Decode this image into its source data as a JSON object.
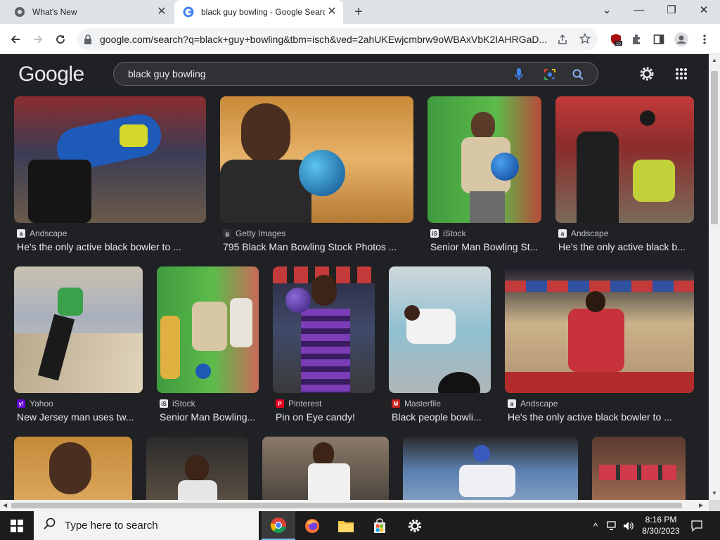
{
  "browser": {
    "tabs": [
      {
        "title": "What's New",
        "active": false
      },
      {
        "title": "black guy bowling - Google Search",
        "active": true
      }
    ],
    "url": "google.com/search?q=black+guy+bowling&tbm=isch&ved=2ahUKEwjcmbrw9oWBAxVbK2IAHRGaD...",
    "extension_badge": "10"
  },
  "google": {
    "logo": "Google",
    "query": "black guy bowling"
  },
  "results": [
    {
      "source": "Andscape",
      "title": "He's the only active black bowler to ...",
      "fav_color": "#e8eaed"
    },
    {
      "source": "Getty Images",
      "title": "795 Black Man Bowling Stock Photos ...",
      "fav_color": "#e8eaed"
    },
    {
      "source": "iStock",
      "title": "Senior Man Bowling St...",
      "fav_color": "#e8eaed"
    },
    {
      "source": "Andscape",
      "title": "He's the only active black b...",
      "fav_color": "#e8eaed"
    },
    {
      "source": "Yahoo",
      "title": "New Jersey man uses tw...",
      "fav_color": "#6001d2"
    },
    {
      "source": "iStock",
      "title": "Senior Man Bowling...",
      "fav_color": "#e8eaed"
    },
    {
      "source": "Pinterest",
      "title": "Pin on Eye candy!",
      "fav_color": "#e60023"
    },
    {
      "source": "Masterfile",
      "title": "Black people bowli...",
      "fav_color": "#c5221f"
    },
    {
      "source": "Andscape",
      "title": "He's the only active black bowler to ...",
      "fav_color": "#e8eaed"
    }
  ],
  "taskbar": {
    "search_placeholder": "Type here to search",
    "time": "8:16 PM",
    "date": "8/30/2023"
  }
}
